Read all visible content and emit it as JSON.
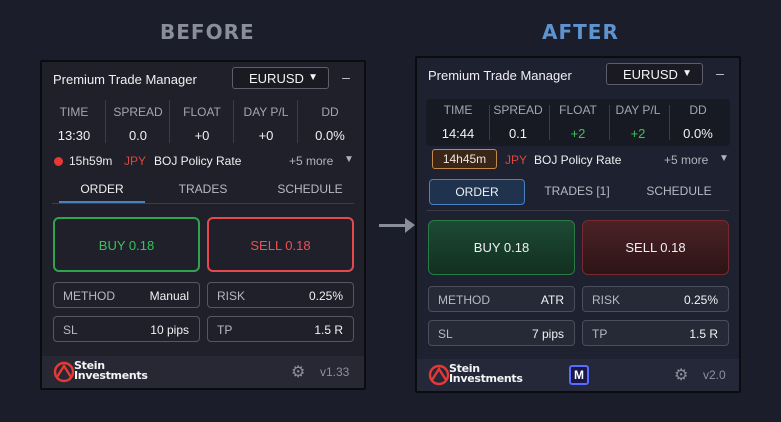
{
  "headings": {
    "before": "BEFORE",
    "after": "AFTER"
  },
  "before": {
    "title": "Premium Trade Manager",
    "symbol": "EURUSD",
    "minimize": "–",
    "stats": [
      {
        "label": "TIME",
        "value": "13:30"
      },
      {
        "label": "SPREAD",
        "value": "0.0"
      },
      {
        "label": "FLOAT",
        "value": "+0"
      },
      {
        "label": "DAY P/L",
        "value": "+0"
      },
      {
        "label": "DD",
        "value": "0.0%"
      }
    ],
    "news": {
      "timer": "15h59m",
      "currency": "JPY",
      "event": "BOJ Policy Rate",
      "more": "+5 more"
    },
    "tabs": [
      "ORDER",
      "TRADES",
      "SCHEDULE"
    ],
    "active_tab": "ORDER",
    "buy": "BUY 0.18",
    "sell": "SELL 0.18",
    "fields": {
      "method": {
        "label": "METHOD",
        "value": "Manual"
      },
      "risk": {
        "label": "RISK",
        "value": "0.25%"
      },
      "sl": {
        "label": "SL",
        "value": "10 pips"
      },
      "tp": {
        "label": "TP",
        "value": "1.5 R"
      }
    },
    "brand": {
      "line1": "Stein",
      "line2": "Investments"
    },
    "version": "v1.33"
  },
  "after": {
    "title": "Premium Trade Manager",
    "symbol": "EURUSD",
    "minimize": "–",
    "stats": [
      {
        "label": "TIME",
        "value": "14:44"
      },
      {
        "label": "SPREAD",
        "value": "0.1"
      },
      {
        "label": "FLOAT",
        "value": "+2"
      },
      {
        "label": "DAY P/L",
        "value": "+2"
      },
      {
        "label": "DD",
        "value": "0.0%"
      }
    ],
    "news": {
      "timer": "14h45m",
      "currency": "JPY",
      "event": "BOJ Policy Rate",
      "more": "+5 more"
    },
    "tabs": [
      "ORDER",
      "TRADES [1]",
      "SCHEDULE"
    ],
    "active_tab": "ORDER",
    "buy": "BUY 0.18",
    "sell": "SELL 0.18",
    "fields": {
      "method": {
        "label": "METHOD",
        "value": "ATR"
      },
      "risk": {
        "label": "RISK",
        "value": "0.25%"
      },
      "sl": {
        "label": "SL",
        "value": "7 pips"
      },
      "tp": {
        "label": "TP",
        "value": "1.5 R"
      }
    },
    "brand": {
      "line1": "Stein",
      "line2": "Investments"
    },
    "badge": "M",
    "version": "v2.0"
  },
  "icons": {
    "symbol_caret": "chevron-down-icon",
    "news_caret": "triangle-down-icon",
    "gear": "gear-icon",
    "arrow": "arrow-right-icon",
    "logo": "stein-investments-logo"
  },
  "colors": {
    "background": "#1c1d2b",
    "buy_green": "#37c25f",
    "sell_red": "#ef5054",
    "accent_blue": "#4a7fc0",
    "news_red": "#e53935",
    "positive_green": "#3fc15c"
  }
}
